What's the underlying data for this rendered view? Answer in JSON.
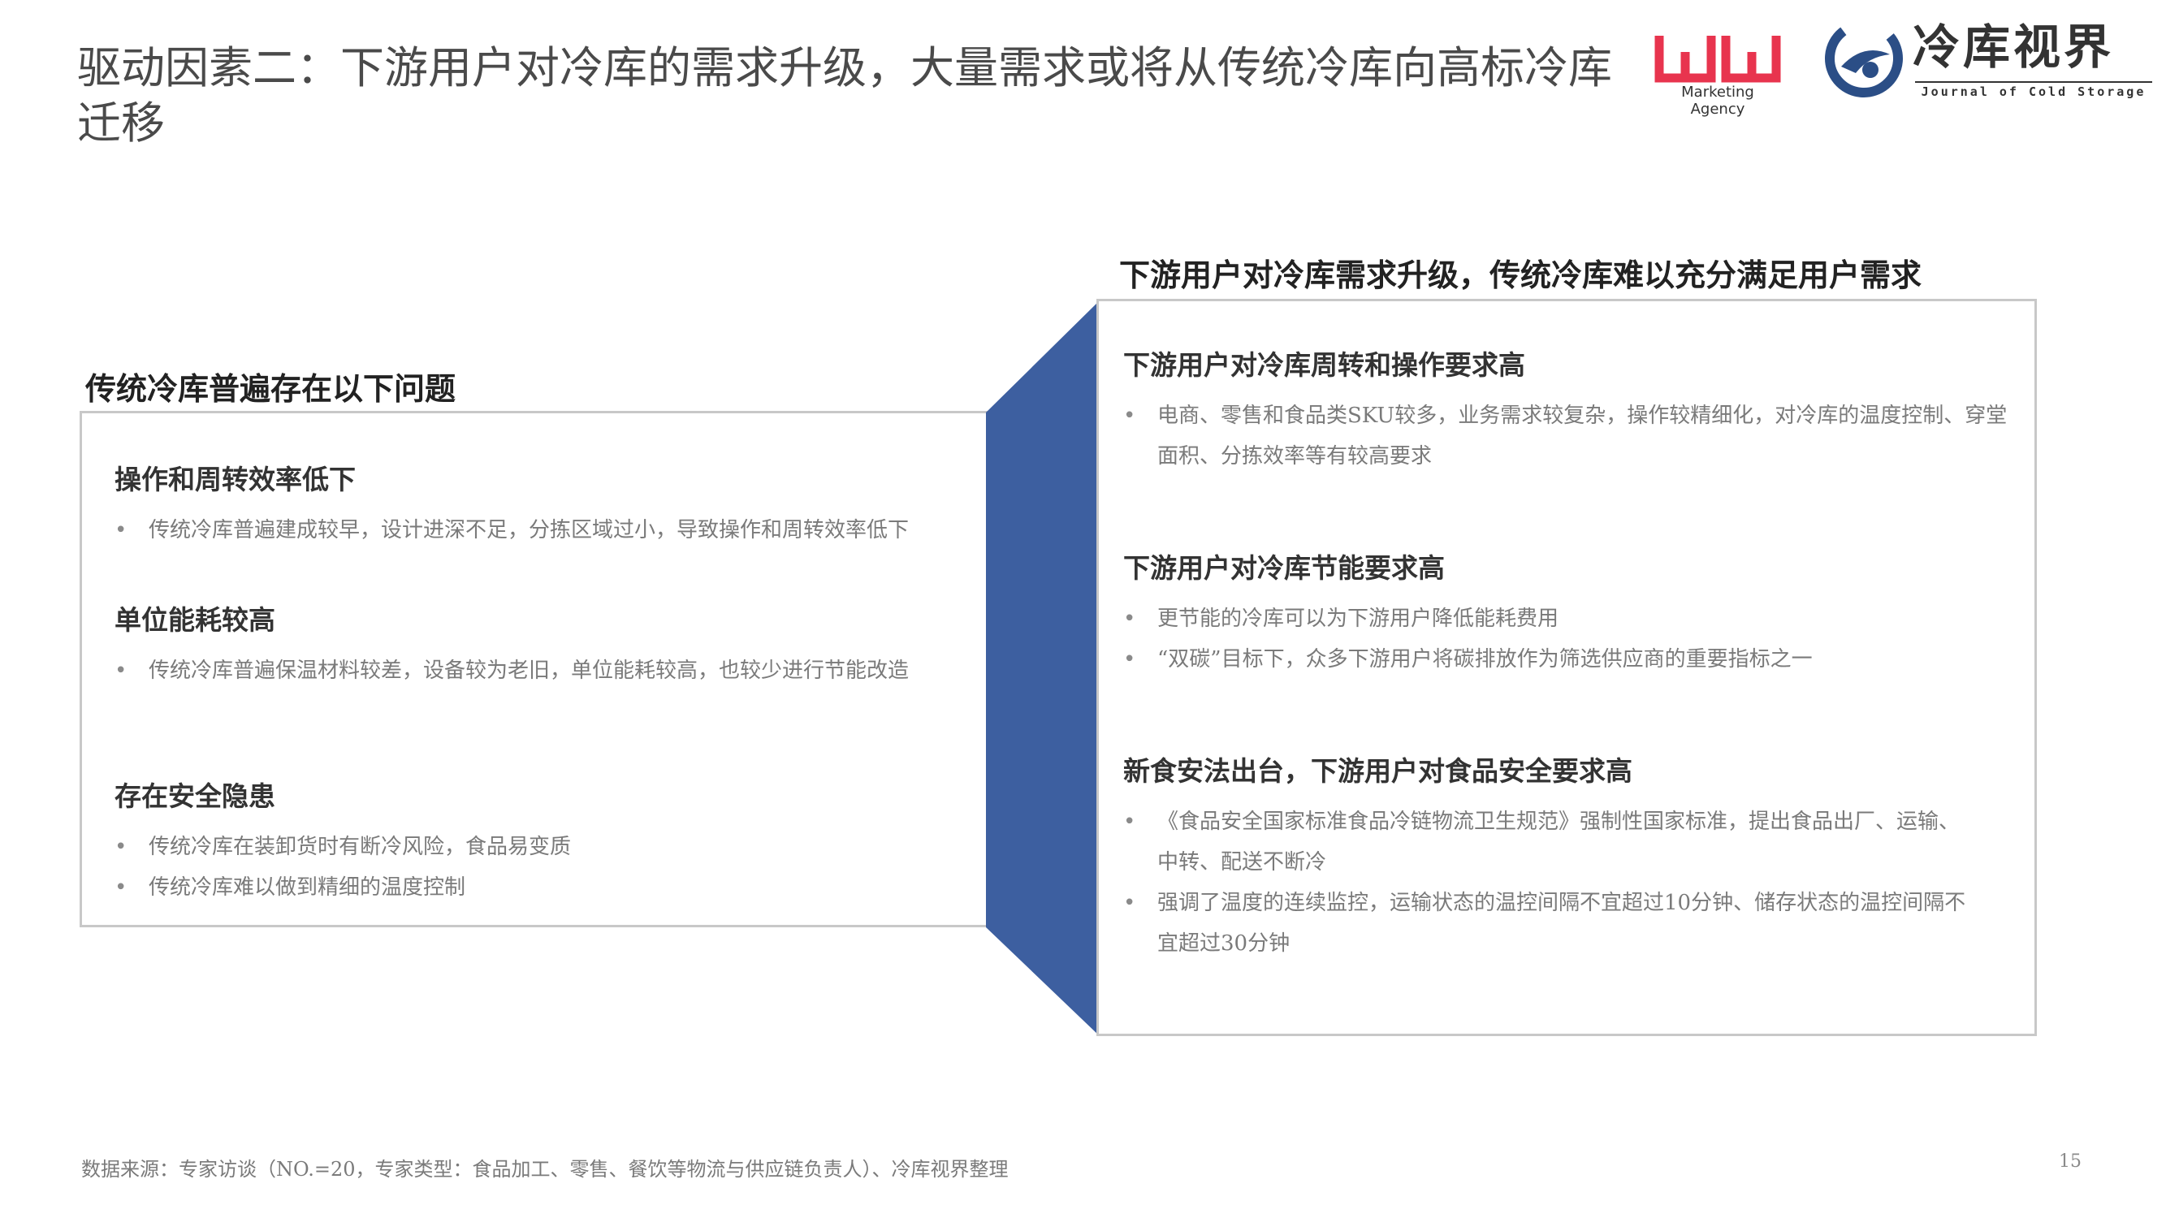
{
  "title": "驱动因素二：下游用户对冷库的需求升级，大量需求或将从传统冷库向高标冷库迁移",
  "logos": {
    "wn_subtitle": "Marketing Agency",
    "cold_storage_name": "冷库视界",
    "cold_storage_subtitle": "Journal of Cold Storage",
    "wn_color": "#e8344e",
    "cold_storage_color": "#2b4e86"
  },
  "left_panel": {
    "heading": "传统冷库普遍存在以下问题",
    "sections": [
      {
        "title": "操作和周转效率低下",
        "bullets": [
          "传统冷库普遍建成较早，设计进深不足，分拣区域过小，导致操作和周转效率低下"
        ]
      },
      {
        "title": "单位能耗较高",
        "bullets": [
          "传统冷库普遍保温材料较差，设备较为老旧，单位能耗较高，也较少进行节能改造"
        ]
      },
      {
        "title": "存在安全隐患",
        "bullets": [
          "传统冷库在装卸货时有断冷风险，食品易变质",
          "传统冷库难以做到精细的温度控制"
        ]
      }
    ]
  },
  "right_panel": {
    "heading": "下游用户对冷库需求升级，传统冷库难以充分满足用户需求",
    "sections": [
      {
        "title": "下游用户对冷库周转和操作要求高",
        "bullets": [
          "电商、零售和食品类SKU较多，业务需求较复杂，操作较精细化，对冷库的温度控制、穿堂面积、分拣效率等有较高要求"
        ]
      },
      {
        "title": "下游用户对冷库节能要求高",
        "bullets": [
          "更节能的冷库可以为下游用户降低能耗费用",
          "“双碳”目标下，众多下游用户将碳排放作为筛选供应商的重要指标之一"
        ]
      },
      {
        "title": "新食安法出台，下游用户对食品安全要求高",
        "bullets": [
          "《食品安全国家标准食品冷链物流卫生规范》强制性国家标准，提出食品出厂、运输、中转、配送不断冷",
          "强调了温度的连续监控，运输状态的温控间隔不宜超过10分钟、储存状态的温控间隔不宜超过30分钟"
        ]
      }
    ]
  },
  "connector_color": "#3d5fa0",
  "source": "数据来源：专家访谈（NO.=20，专家类型：食品加工、零售、餐饮等物流与供应链负责人）、冷库视界整理",
  "page_number": "15"
}
